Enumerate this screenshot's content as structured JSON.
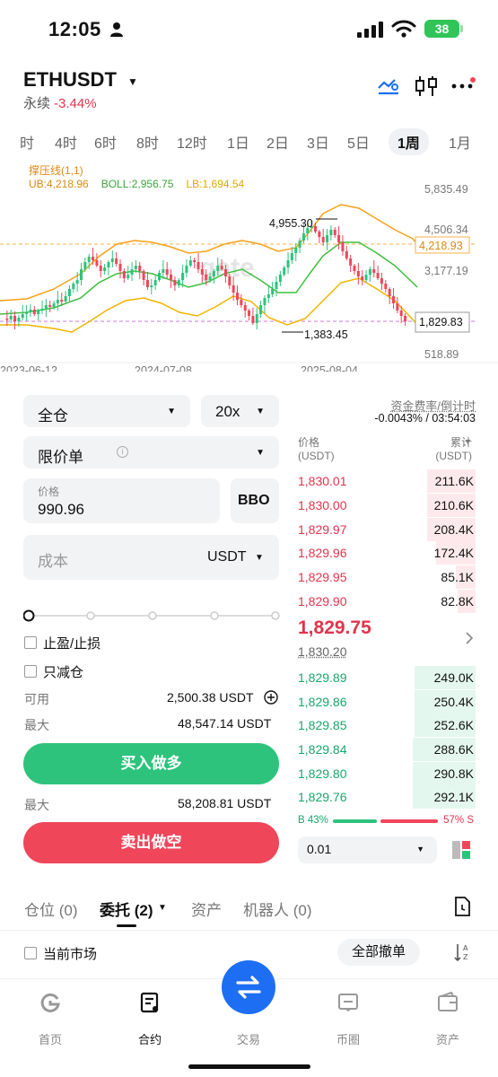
{
  "status": {
    "time": "12:05",
    "battery": "38"
  },
  "header": {
    "pair": "ETHUSDT",
    "type": "永续",
    "change": "-3.44%"
  },
  "timeframes": [
    "时",
    "4时",
    "6时",
    "8时",
    "12时",
    "1日",
    "2日",
    "3日",
    "5日",
    "1周",
    "1月"
  ],
  "timeframe_active": "1周",
  "chart": {
    "indicator": "撑压线(1,1)",
    "ub": "UB:4,218.96",
    "boll": "BOLL:2,956.75",
    "lb": "LB:1,694.54",
    "y_labels": [
      "5,835.49",
      "4,506.34",
      "3,177.19",
      "518.89"
    ],
    "high_price": "4,955.30",
    "low_price": "1,383.45",
    "ub_tag": "4,218.93",
    "last_tag": "1,829.83",
    "dates": [
      "2023-06-12",
      "2024-07-08",
      "2025-08-04"
    ],
    "watermark": "gate",
    "colors": {
      "up": "#2ec37c",
      "down": "#f0465a",
      "ub": "#f7a21b",
      "mid": "#3fbf3f",
      "lb": "#f0b400"
    }
  },
  "form": {
    "margin_mode": "全仓",
    "leverage": "20x",
    "order_type": "限价单",
    "price_label": "价格",
    "price_value": "990.96",
    "bbo": "BBO",
    "cost_placeholder": "成本",
    "cost_unit": "USDT",
    "tp_sl": "止盈/止损",
    "reduce_only": "只减仓",
    "available_label": "可用",
    "available_value": "2,500.38 USDT",
    "max_label": "最大",
    "max_buy": "48,547.14 USDT",
    "buy_label": "买入做多",
    "max_sell": "58,208.81 USDT",
    "sell_label": "卖出做空"
  },
  "orderbook": {
    "funding_label": "资金费率/倒计时",
    "funding_value": "-0.0043% / 03:54:03",
    "col_price": "价格",
    "col_price_unit": "(USDT)",
    "col_total": "累计",
    "col_total_unit": "(USDT)",
    "asks": [
      {
        "price": "1,830.01",
        "qty": "211.6K",
        "depth": 0.27
      },
      {
        "price": "1,830.00",
        "qty": "210.6K",
        "depth": 0.27
      },
      {
        "price": "1,829.97",
        "qty": "208.4K",
        "depth": 0.27
      },
      {
        "price": "1,829.96",
        "qty": "172.4K",
        "depth": 0.22
      },
      {
        "price": "1,829.95",
        "qty": "85.1K",
        "depth": 0.11
      },
      {
        "price": "1,829.90",
        "qty": "82.8K",
        "depth": 0.1
      }
    ],
    "last_price": "1,829.75",
    "mark_price": "1,830.20",
    "bids": [
      {
        "price": "1,829.89",
        "qty": "249.0K",
        "depth": 0.34
      },
      {
        "price": "1,829.86",
        "qty": "250.4K",
        "depth": 0.34
      },
      {
        "price": "1,829.85",
        "qty": "252.6K",
        "depth": 0.34
      },
      {
        "price": "1,829.84",
        "qty": "288.6K",
        "depth": 0.35
      },
      {
        "price": "1,829.80",
        "qty": "290.8K",
        "depth": 0.35
      },
      {
        "price": "1,829.76",
        "qty": "292.1K",
        "depth": 0.35
      }
    ],
    "buy_ratio": "B 43%",
    "sell_ratio": "57% S",
    "buy_pct": 43,
    "precision": "0.01"
  },
  "bottom_tabs": {
    "positions": "仓位 (0)",
    "orders": "委托 (2)",
    "assets": "资产",
    "bots": "机器人 (0)",
    "current_market": "当前市场",
    "cancel_all": "全部撤单"
  },
  "nav": {
    "home": "首页",
    "futures": "合约",
    "trade": "交易",
    "feed": "币圈",
    "assets": "资产"
  }
}
